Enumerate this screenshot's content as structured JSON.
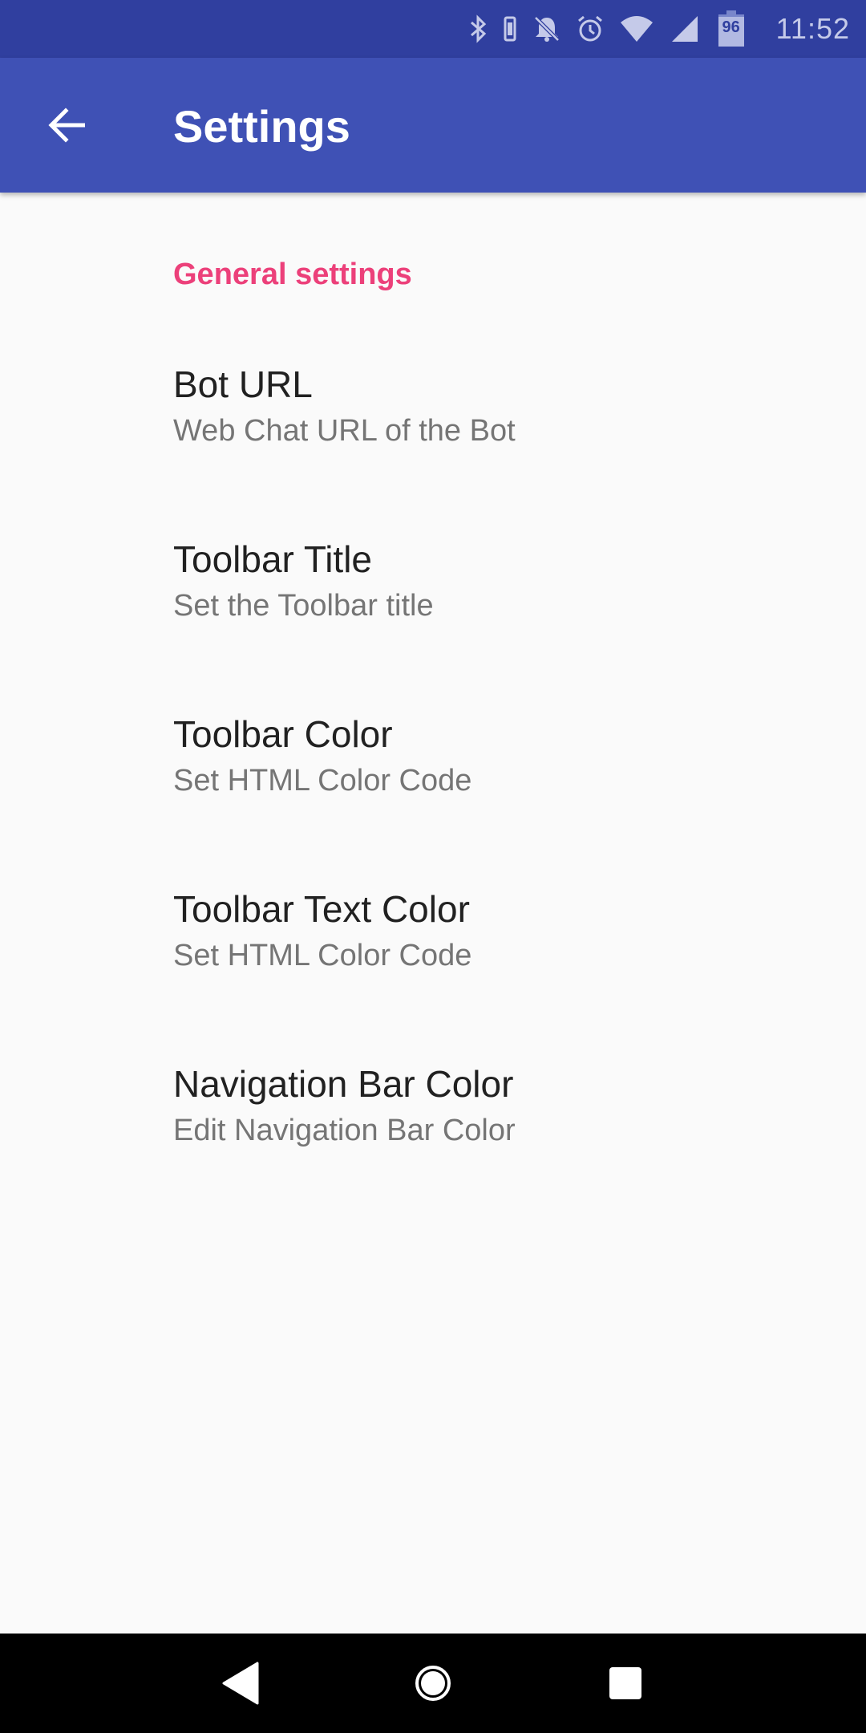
{
  "status_bar": {
    "time": "11:52",
    "battery_level": "96",
    "icons": [
      "bluetooth-icon",
      "vibrate-icon",
      "notifications-off-icon",
      "alarm-icon",
      "wifi-icon",
      "cell-signal-icon",
      "battery-icon"
    ],
    "background": "#303F9F"
  },
  "app_bar": {
    "title": "Settings",
    "back_icon": "arrow-back-icon",
    "background": "#3F51B5"
  },
  "section": {
    "header": "General settings",
    "accent_color": "#EC407A"
  },
  "preferences": [
    {
      "title": "Bot URL",
      "summary": "Web Chat URL of the Bot"
    },
    {
      "title": "Toolbar Title",
      "summary": "Set the Toolbar title"
    },
    {
      "title": "Toolbar Color",
      "summary": "Set HTML Color Code"
    },
    {
      "title": "Toolbar Text Color",
      "summary": "Set HTML Color Code"
    },
    {
      "title": "Navigation Bar Color",
      "summary": "Edit Navigation Bar Color"
    }
  ],
  "nav_bar": {
    "buttons": [
      "back-icon",
      "home-icon",
      "recents-icon"
    ]
  }
}
